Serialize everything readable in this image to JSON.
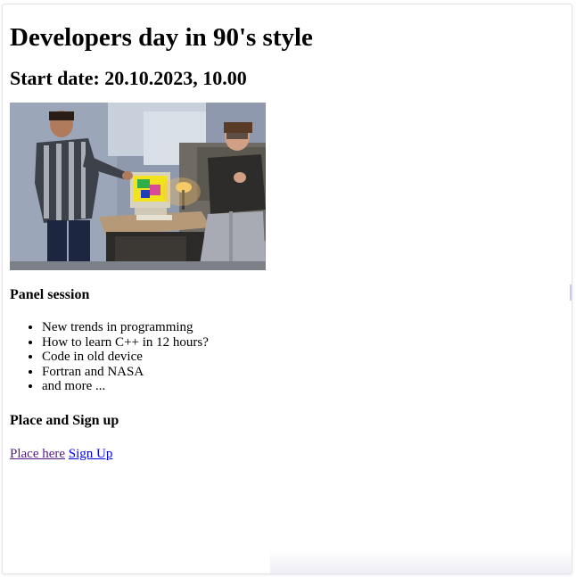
{
  "page": {
    "title": "Developers day in 90's style",
    "start_date": "Start date: 20.10.2023, 10.00"
  },
  "image": {
    "icon": "dancing-developers-photo"
  },
  "panel": {
    "heading": "Panel session",
    "items": [
      "New trends in programming",
      "How to learn C++ in 12 hours?",
      "Code in old device",
      "Fortran and NASA",
      "and more ..."
    ]
  },
  "signup": {
    "heading": "Place and Sign up",
    "place_link": "Place here",
    "signup_link": "Sign Up"
  },
  "colors": {
    "visited_link": "#551a8b",
    "link": "#0000ee"
  }
}
